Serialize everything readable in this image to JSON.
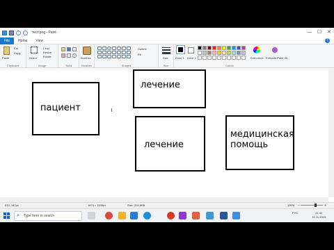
{
  "window": {
    "title": "тест.png - Paint",
    "controls": {
      "minimize": "—",
      "maximize": "☐",
      "close": "✕"
    }
  },
  "tabs": [
    {
      "label": "File"
    },
    {
      "label": "Home"
    },
    {
      "label": "View"
    }
  ],
  "ribbon": {
    "clipboard": {
      "label": "Clipboard",
      "paste": "Paste",
      "cut": "Cut",
      "copy": "Copy"
    },
    "image": {
      "label": "Image",
      "select": "Select",
      "crop": "Crop",
      "resize": "Resize",
      "rotate": "Rotate"
    },
    "tools": {
      "label": "Tools"
    },
    "brushes": {
      "label": "Brushes"
    },
    "shapes": {
      "label": "Shapes",
      "outline": "Outline",
      "fill": "Fill"
    },
    "size": {
      "label": "Size"
    },
    "colors": {
      "label": "Colors",
      "color1": "Color 1",
      "color2": "Color 2",
      "edit_colors": "Edit colors",
      "edit_paint3d": "Edit with Paint 3D",
      "palette": [
        "#000000",
        "#7f7f7f",
        "#880015",
        "#ed1c24",
        "#ff7f27",
        "#fff200",
        "#22b14c",
        "#00a2e8",
        "#3f48cc",
        "#a349a4",
        "#ffffff",
        "#c3c3c3",
        "#b97a57",
        "#ffaec9",
        "#ffc90e",
        "#efe4b0",
        "#b5e61d",
        "#99d9ea",
        "#7092be",
        "#c8bfe7",
        "#ffffff",
        "#ffffff",
        "#ffffff",
        "#ffffff",
        "#ffffff",
        "#ffffff",
        "#ffffff",
        "#ffffff",
        "#ffffff",
        "#ffffff"
      ]
    }
  },
  "canvas": {
    "boxes": [
      {
        "text": "пациент"
      },
      {
        "text": "лечение"
      },
      {
        "text": "лечение"
      },
      {
        "text": "медицинская помощь"
      }
    ]
  },
  "statusbar": {
    "cursor_pos": "470, 187px",
    "selection_size": "1874 × 1156px",
    "file_size": "Size: 234,8KB",
    "zoom": "100%"
  },
  "taskbar": {
    "search_placeholder": "Type here to search",
    "language": "РУС",
    "time": "21:40",
    "date": "11.11.2023"
  }
}
